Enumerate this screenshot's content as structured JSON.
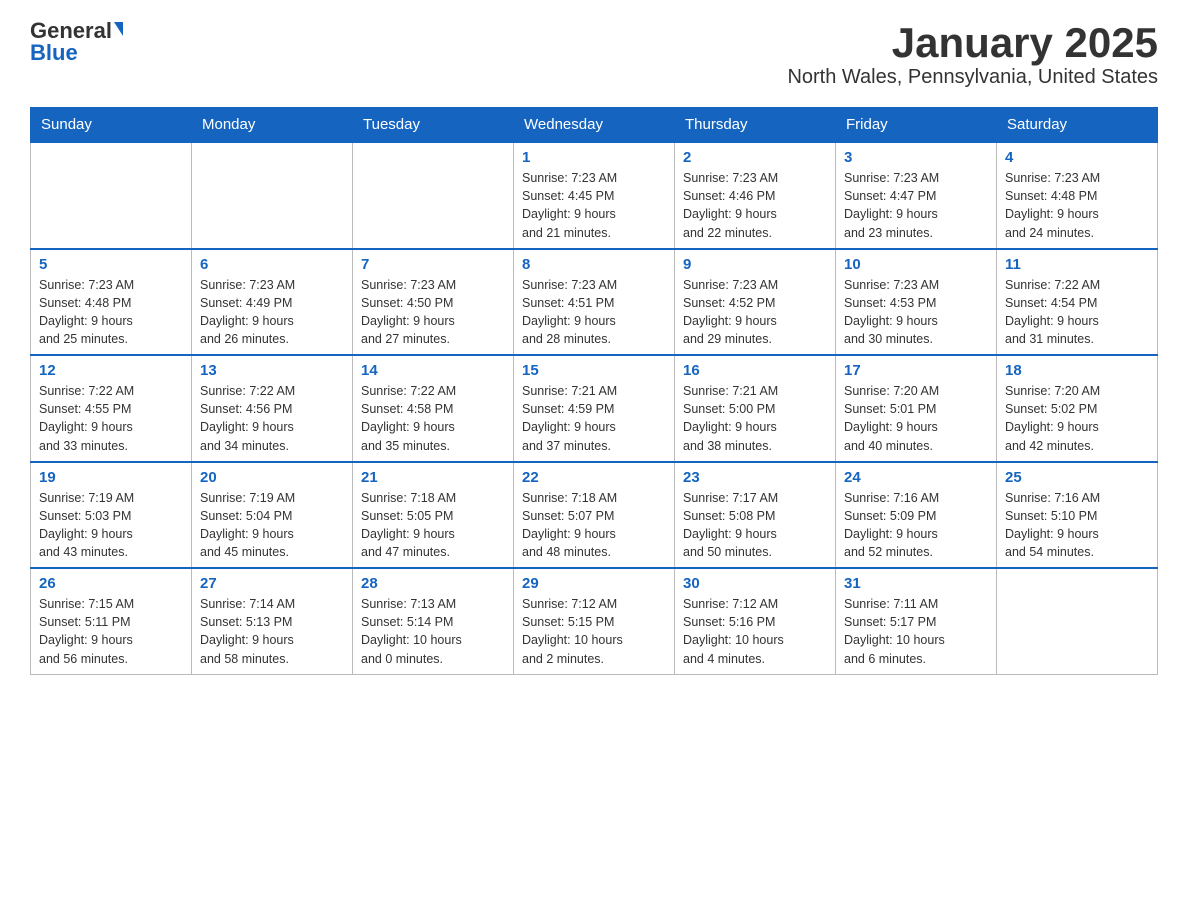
{
  "header": {
    "logo_general": "General",
    "logo_blue": "Blue",
    "title": "January 2025",
    "subtitle": "North Wales, Pennsylvania, United States"
  },
  "days_of_week": [
    "Sunday",
    "Monday",
    "Tuesday",
    "Wednesday",
    "Thursday",
    "Friday",
    "Saturday"
  ],
  "weeks": [
    [
      {
        "day": null,
        "info": null
      },
      {
        "day": null,
        "info": null
      },
      {
        "day": null,
        "info": null
      },
      {
        "day": "1",
        "info": "Sunrise: 7:23 AM\nSunset: 4:45 PM\nDaylight: 9 hours\nand 21 minutes."
      },
      {
        "day": "2",
        "info": "Sunrise: 7:23 AM\nSunset: 4:46 PM\nDaylight: 9 hours\nand 22 minutes."
      },
      {
        "day": "3",
        "info": "Sunrise: 7:23 AM\nSunset: 4:47 PM\nDaylight: 9 hours\nand 23 minutes."
      },
      {
        "day": "4",
        "info": "Sunrise: 7:23 AM\nSunset: 4:48 PM\nDaylight: 9 hours\nand 24 minutes."
      }
    ],
    [
      {
        "day": "5",
        "info": "Sunrise: 7:23 AM\nSunset: 4:48 PM\nDaylight: 9 hours\nand 25 minutes."
      },
      {
        "day": "6",
        "info": "Sunrise: 7:23 AM\nSunset: 4:49 PM\nDaylight: 9 hours\nand 26 minutes."
      },
      {
        "day": "7",
        "info": "Sunrise: 7:23 AM\nSunset: 4:50 PM\nDaylight: 9 hours\nand 27 minutes."
      },
      {
        "day": "8",
        "info": "Sunrise: 7:23 AM\nSunset: 4:51 PM\nDaylight: 9 hours\nand 28 minutes."
      },
      {
        "day": "9",
        "info": "Sunrise: 7:23 AM\nSunset: 4:52 PM\nDaylight: 9 hours\nand 29 minutes."
      },
      {
        "day": "10",
        "info": "Sunrise: 7:23 AM\nSunset: 4:53 PM\nDaylight: 9 hours\nand 30 minutes."
      },
      {
        "day": "11",
        "info": "Sunrise: 7:22 AM\nSunset: 4:54 PM\nDaylight: 9 hours\nand 31 minutes."
      }
    ],
    [
      {
        "day": "12",
        "info": "Sunrise: 7:22 AM\nSunset: 4:55 PM\nDaylight: 9 hours\nand 33 minutes."
      },
      {
        "day": "13",
        "info": "Sunrise: 7:22 AM\nSunset: 4:56 PM\nDaylight: 9 hours\nand 34 minutes."
      },
      {
        "day": "14",
        "info": "Sunrise: 7:22 AM\nSunset: 4:58 PM\nDaylight: 9 hours\nand 35 minutes."
      },
      {
        "day": "15",
        "info": "Sunrise: 7:21 AM\nSunset: 4:59 PM\nDaylight: 9 hours\nand 37 minutes."
      },
      {
        "day": "16",
        "info": "Sunrise: 7:21 AM\nSunset: 5:00 PM\nDaylight: 9 hours\nand 38 minutes."
      },
      {
        "day": "17",
        "info": "Sunrise: 7:20 AM\nSunset: 5:01 PM\nDaylight: 9 hours\nand 40 minutes."
      },
      {
        "day": "18",
        "info": "Sunrise: 7:20 AM\nSunset: 5:02 PM\nDaylight: 9 hours\nand 42 minutes."
      }
    ],
    [
      {
        "day": "19",
        "info": "Sunrise: 7:19 AM\nSunset: 5:03 PM\nDaylight: 9 hours\nand 43 minutes."
      },
      {
        "day": "20",
        "info": "Sunrise: 7:19 AM\nSunset: 5:04 PM\nDaylight: 9 hours\nand 45 minutes."
      },
      {
        "day": "21",
        "info": "Sunrise: 7:18 AM\nSunset: 5:05 PM\nDaylight: 9 hours\nand 47 minutes."
      },
      {
        "day": "22",
        "info": "Sunrise: 7:18 AM\nSunset: 5:07 PM\nDaylight: 9 hours\nand 48 minutes."
      },
      {
        "day": "23",
        "info": "Sunrise: 7:17 AM\nSunset: 5:08 PM\nDaylight: 9 hours\nand 50 minutes."
      },
      {
        "day": "24",
        "info": "Sunrise: 7:16 AM\nSunset: 5:09 PM\nDaylight: 9 hours\nand 52 minutes."
      },
      {
        "day": "25",
        "info": "Sunrise: 7:16 AM\nSunset: 5:10 PM\nDaylight: 9 hours\nand 54 minutes."
      }
    ],
    [
      {
        "day": "26",
        "info": "Sunrise: 7:15 AM\nSunset: 5:11 PM\nDaylight: 9 hours\nand 56 minutes."
      },
      {
        "day": "27",
        "info": "Sunrise: 7:14 AM\nSunset: 5:13 PM\nDaylight: 9 hours\nand 58 minutes."
      },
      {
        "day": "28",
        "info": "Sunrise: 7:13 AM\nSunset: 5:14 PM\nDaylight: 10 hours\nand 0 minutes."
      },
      {
        "day": "29",
        "info": "Sunrise: 7:12 AM\nSunset: 5:15 PM\nDaylight: 10 hours\nand 2 minutes."
      },
      {
        "day": "30",
        "info": "Sunrise: 7:12 AM\nSunset: 5:16 PM\nDaylight: 10 hours\nand 4 minutes."
      },
      {
        "day": "31",
        "info": "Sunrise: 7:11 AM\nSunset: 5:17 PM\nDaylight: 10 hours\nand 6 minutes."
      },
      {
        "day": null,
        "info": null
      }
    ]
  ]
}
